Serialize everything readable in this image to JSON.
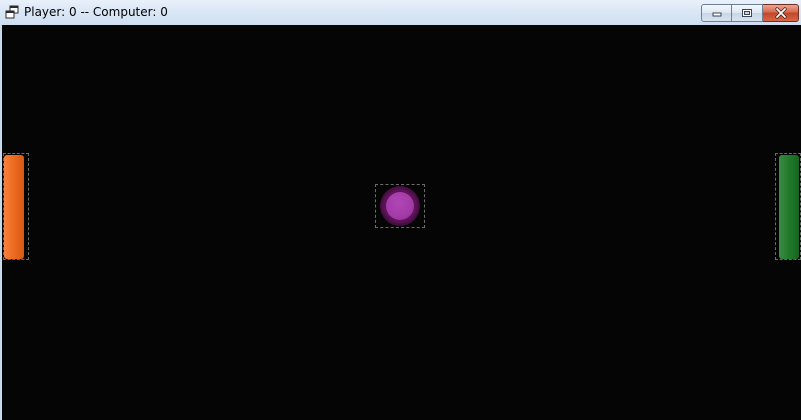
{
  "window": {
    "title": "Player: 0 -- Computer: 0",
    "controls": {
      "minimize_icon": "minimize-icon",
      "maximize_icon": "maximize-icon",
      "close_icon": "close-icon"
    }
  },
  "game": {
    "background_color": "#050505",
    "player_paddle_color": "#ec6a20",
    "computer_paddle_color": "#217a2c",
    "ball_color": "#a23aa7"
  }
}
